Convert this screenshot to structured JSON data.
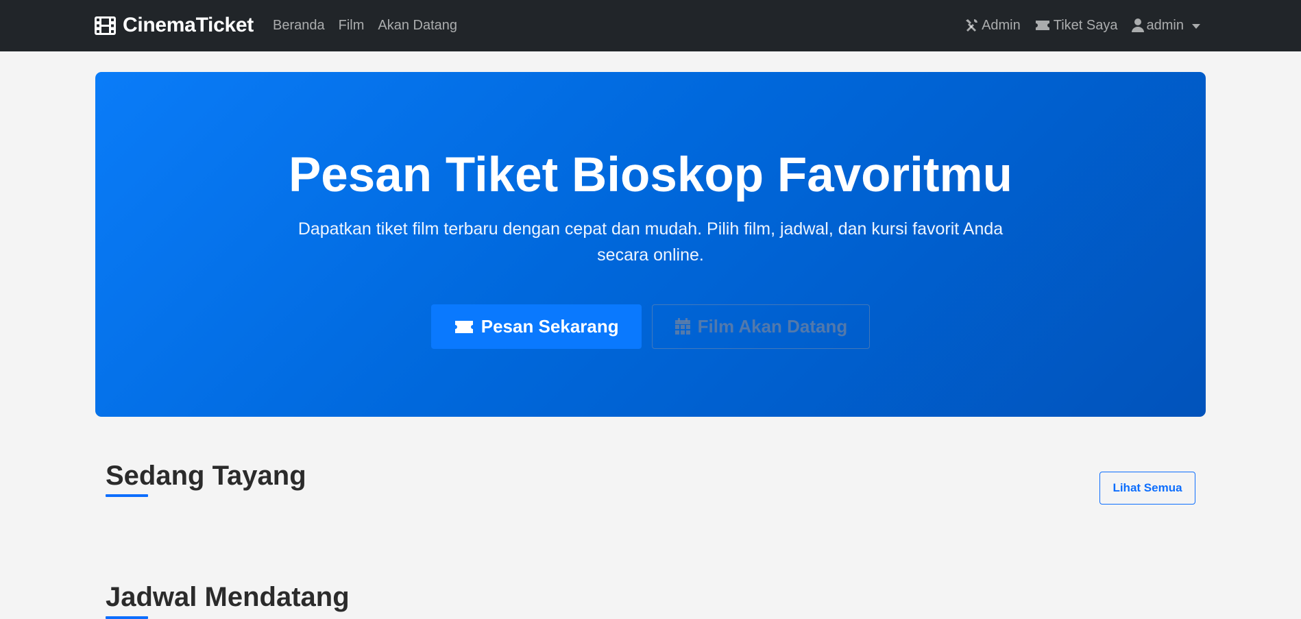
{
  "navbar": {
    "brand": "CinemaTicket",
    "brand_icon": "film-icon",
    "links": [
      "Beranda",
      "Film",
      "Akan Datang"
    ],
    "admin_label": "Admin",
    "tickets_label": "Tiket Saya",
    "user_label": "admin"
  },
  "hero": {
    "title": "Pesan Tiket Bioskop Favoritmu",
    "subtitle": "Dapatkan tiket film terbaru dengan cepat dan mudah. Pilih film, jadwal, dan kursi favorit Anda secara online.",
    "primary_button": "Pesan Sekarang",
    "secondary_button": "Film Akan Datang"
  },
  "sections": {
    "now_showing_title": "Sedang Tayang",
    "see_all_label": "Lihat Semua",
    "upcoming_title": "Jadwal Mendatang"
  },
  "colors": {
    "navbar_bg": "#212529",
    "hero_start": "#0a7cf8",
    "hero_end": "#0153bb",
    "accent": "#0d6efd",
    "page_bg": "#f4f4f4"
  }
}
